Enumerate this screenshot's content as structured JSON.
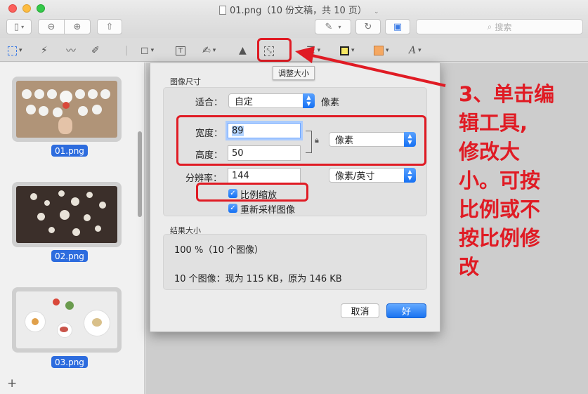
{
  "window": {
    "title": "01.png（10 份文稿，共 10 页）"
  },
  "toolbar": {
    "search_placeholder": "搜索",
    "resize_tooltip": "调整大小"
  },
  "sidebar": {
    "thumbnails": [
      {
        "label": "01.png",
        "selected": true
      },
      {
        "label": "02.png",
        "selected": true
      },
      {
        "label": "03.png",
        "selected": true
      }
    ],
    "add_label": "+"
  },
  "dialog": {
    "section_size": "图像尺寸",
    "fit_label": "适合：",
    "fit_value": "自定",
    "fit_unit": "像素",
    "width_label": "宽度：",
    "width_value": "89",
    "height_label": "高度：",
    "height_value": "50",
    "size_unit_value": "像素",
    "resolution_label": "分辨率：",
    "resolution_value": "144",
    "resolution_unit_value": "像素/英寸",
    "scale_proportionally_label": "比例缩放",
    "scale_proportionally_checked": true,
    "resample_label": "重新采样图像",
    "resample_checked": true,
    "section_result": "结果大小",
    "result_percent": "100 %（10 个图像）",
    "result_summary": "10 个图像：现为 115 KB，原为 146 KB",
    "cancel_label": "取消",
    "ok_label": "好"
  },
  "annotation": {
    "lines": [
      "3、单击编",
      "辑工具,",
      "修改大",
      "小。可按",
      "比例或不",
      "按比例修",
      "改"
    ],
    "color": "#e01b24"
  },
  "colors": {
    "accent": "#1a73f0",
    "selection": "#2d6cde",
    "annotation_red": "#e01b24"
  }
}
